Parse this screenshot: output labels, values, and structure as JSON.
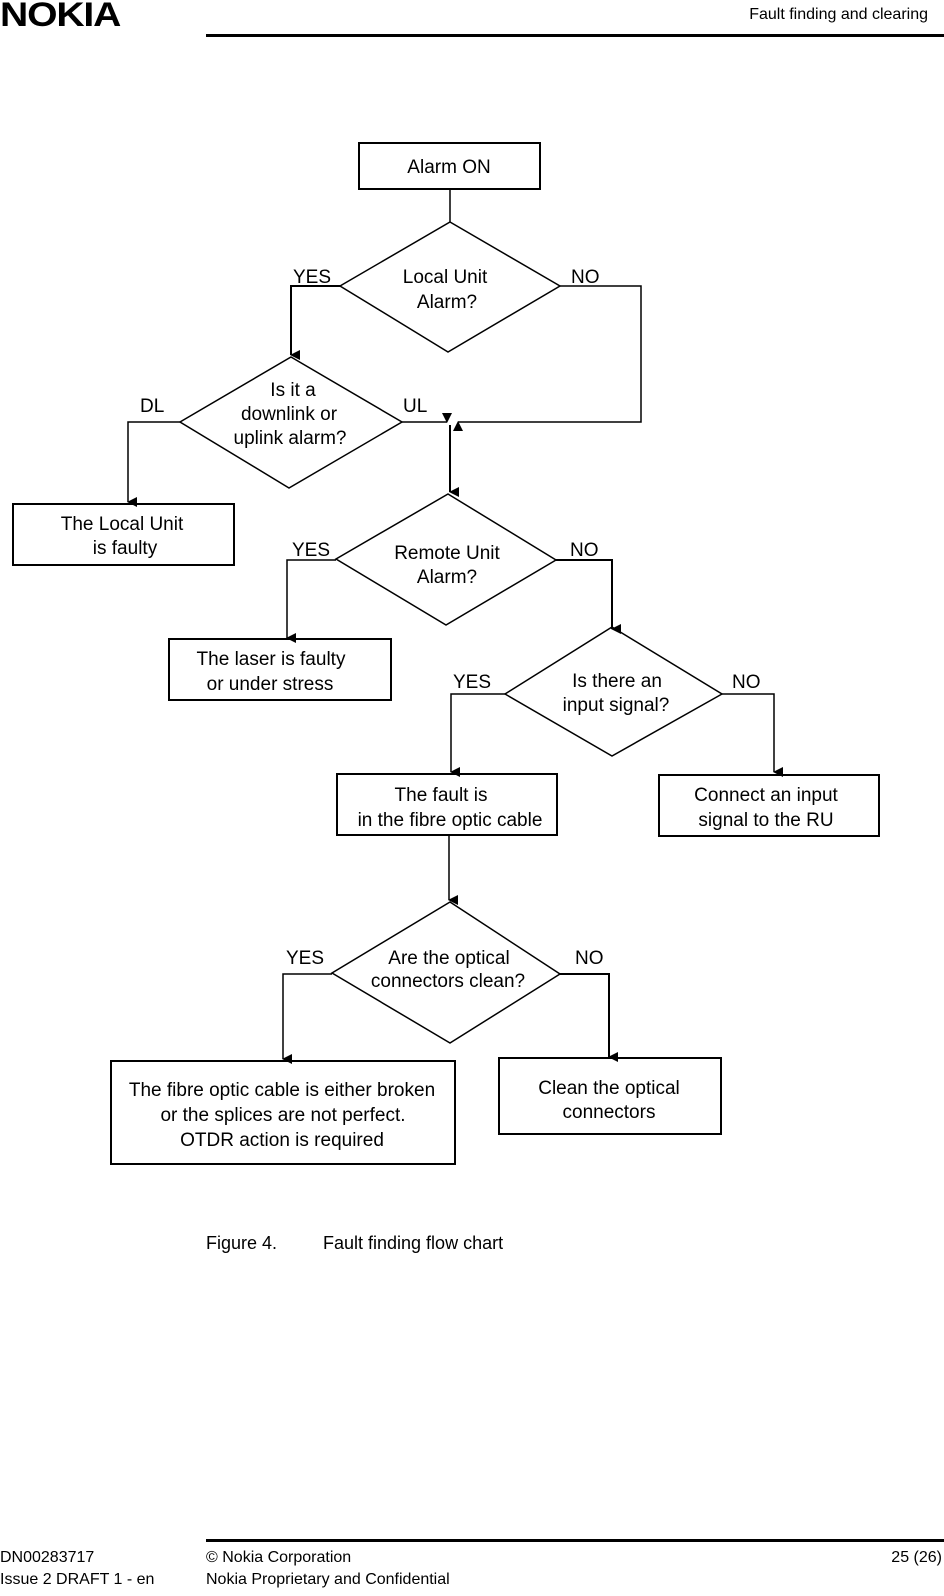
{
  "header": {
    "logo": "NOKIA",
    "section_title": "Fault finding and clearing"
  },
  "flowchart": {
    "start": "Alarm ON",
    "local_unit_alarm": [
      "Local Unit",
      "Alarm?"
    ],
    "dl_ul": [
      "Is it a",
      "downlink or",
      "uplink alarm?"
    ],
    "local_unit_faulty": [
      "The Local Unit",
      "is faulty"
    ],
    "remote_unit_alarm": [
      "Remote Unit",
      "Alarm?"
    ],
    "laser_faulty": [
      "The laser is faulty",
      "or under stress"
    ],
    "input_signal": [
      "Is there an",
      "input signal?"
    ],
    "fault_in_fibre": [
      "The fault is",
      "in the fibre optic cable"
    ],
    "connect_input": [
      "Connect an input",
      "signal to the RU"
    ],
    "connectors_clean": [
      "Are the optical",
      "connectors clean?"
    ],
    "cable_broken": [
      "The fibre optic cable is either broken",
      "or the splices are not perfect.",
      "OTDR action is required"
    ],
    "clean_connectors": [
      "Clean the optical",
      "connectors"
    ],
    "labels": {
      "yes": "YES",
      "no": "NO",
      "dl": "DL",
      "ul": "UL"
    }
  },
  "caption": {
    "number": "Figure 4.",
    "title": "Fault finding flow chart"
  },
  "footer": {
    "doc_id": "DN00283717",
    "issue": "Issue 2 DRAFT 1 - en",
    "copyright": "© Nokia Corporation",
    "confidentiality": "Nokia Proprietary and Confidential",
    "page": "25 (26)"
  }
}
